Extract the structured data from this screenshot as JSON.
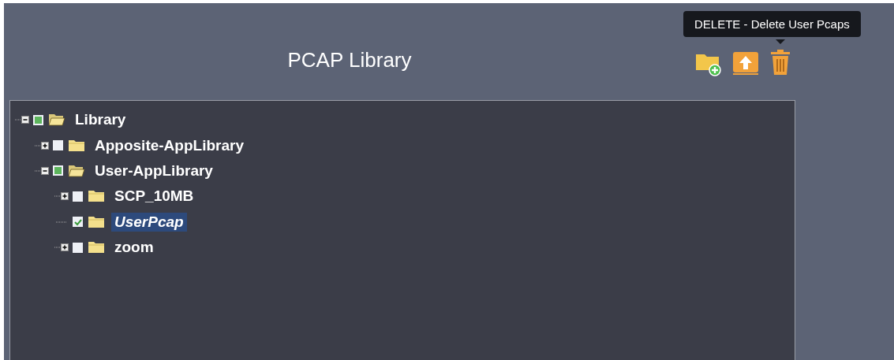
{
  "header": {
    "title": "PCAP Library"
  },
  "toolbar": {
    "tooltip": "DELETE - Delete User Pcaps"
  },
  "tree": [
    {
      "label": "Library",
      "expanded": true,
      "checked": false,
      "partial": true,
      "selected": false,
      "children": [
        {
          "label": "Apposite-AppLibrary",
          "expanded": false,
          "checked": false,
          "partial": false,
          "selected": false,
          "has_children": true
        },
        {
          "label": "User-AppLibrary",
          "expanded": true,
          "checked": false,
          "partial": true,
          "selected": false,
          "children": [
            {
              "label": "SCP_10MB",
              "expanded": false,
              "checked": false,
              "partial": false,
              "selected": false,
              "has_children": true
            },
            {
              "label": "UserPcap",
              "checked": true,
              "partial": false,
              "selected": true,
              "has_children": false
            },
            {
              "label": "zoom",
              "expanded": false,
              "checked": false,
              "partial": false,
              "selected": false,
              "has_children": true
            }
          ]
        }
      ]
    }
  ]
}
